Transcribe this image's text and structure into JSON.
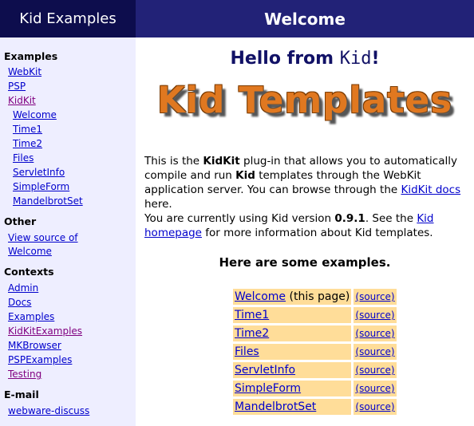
{
  "sidebar": {
    "title": "Kid Examples",
    "sections": [
      {
        "heading": "Examples",
        "items": [
          {
            "label": "WebKit",
            "indent": 0,
            "visited": false
          },
          {
            "label": "PSP",
            "indent": 0,
            "visited": false
          },
          {
            "label": "KidKit",
            "indent": 0,
            "visited": true
          },
          {
            "label": "Welcome",
            "indent": 1,
            "visited": false
          },
          {
            "label": "Time1",
            "indent": 1,
            "visited": false
          },
          {
            "label": "Time2",
            "indent": 1,
            "visited": false
          },
          {
            "label": "Files",
            "indent": 1,
            "visited": false
          },
          {
            "label": "ServletInfo",
            "indent": 1,
            "visited": false
          },
          {
            "label": "SimpleForm",
            "indent": 1,
            "visited": false
          },
          {
            "label": "MandelbrotSet",
            "indent": 1,
            "visited": false
          }
        ]
      },
      {
        "heading": "Other",
        "items": [
          {
            "label": "View source of",
            "indent": 0,
            "visited": false
          },
          {
            "label": "Welcome",
            "indent": 0,
            "visited": false
          }
        ]
      },
      {
        "heading": "Contexts",
        "items": [
          {
            "label": "Admin",
            "indent": 0,
            "visited": false
          },
          {
            "label": "Docs",
            "indent": 0,
            "visited": false
          },
          {
            "label": "Examples",
            "indent": 0,
            "visited": false
          },
          {
            "label": "KidKitExamples",
            "indent": 0,
            "visited": true
          },
          {
            "label": "MKBrowser",
            "indent": 0,
            "visited": false
          },
          {
            "label": "PSPExamples",
            "indent": 0,
            "visited": false
          },
          {
            "label": "Testing",
            "indent": 0,
            "visited": true
          }
        ]
      },
      {
        "heading": "E-mail",
        "items": [
          {
            "label": "webware-discuss",
            "indent": 0,
            "visited": false
          }
        ]
      }
    ]
  },
  "main": {
    "header": "Welcome",
    "hello_prefix": "Hello from ",
    "hello_kid": "Kid",
    "hello_suffix": "!",
    "banner": "Kid Templates",
    "para1": {
      "t1": "This is the ",
      "b1": "KidKit",
      "t2": " plug-in that allows you to automatically compile and run ",
      "b2": "Kid",
      "t3": " templates through the WebKit application server. You can browse through the ",
      "link": "KidKit docs",
      "t4": " here."
    },
    "para2": {
      "t1": "You are currently using Kid version ",
      "version": "0.9.1",
      "t2": ". See the ",
      "link": "Kid homepage",
      "t3": " for more information about Kid templates."
    },
    "examples_title": "Here are some examples.",
    "examples": [
      {
        "name": "Welcome",
        "note": " (this page)",
        "source": "(source)"
      },
      {
        "name": "Time1",
        "note": "",
        "source": "(source)"
      },
      {
        "name": "Time2",
        "note": "",
        "source": "(source)"
      },
      {
        "name": "Files",
        "note": "",
        "source": "(source)"
      },
      {
        "name": "ServletInfo",
        "note": "",
        "source": "(source)"
      },
      {
        "name": "SimpleForm",
        "note": "",
        "source": "(source)"
      },
      {
        "name": "MandelbrotSet",
        "note": "",
        "source": "(source)"
      }
    ]
  },
  "colors": {
    "sidebar_header_bg": "#0d0d4d",
    "main_header_bg": "#222277",
    "sidebar_bg": "#eeeeff",
    "link": "#0000cc",
    "visited_link": "#800080",
    "example_cell_bg": "#ffdd99",
    "banner_orange": "#e07820"
  }
}
